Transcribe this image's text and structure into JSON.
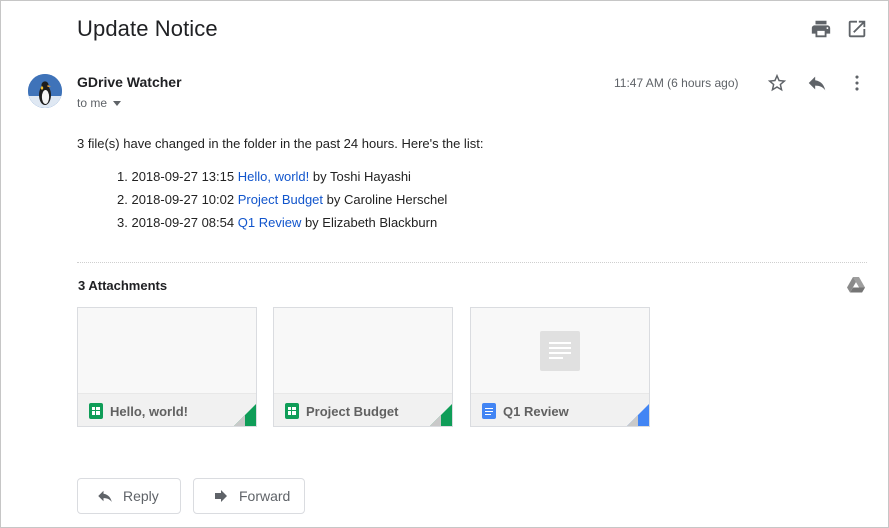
{
  "email": {
    "subject": "Update Notice",
    "sender": "GDrive Watcher",
    "recipient_label": "to me",
    "timestamp": "11:47 AM (6 hours ago)",
    "intro": "3 file(s) have changed in the folder in the past 24 hours. Here's the list:",
    "changes": [
      {
        "number": "1.",
        "datetime": "2018-09-27 13:15",
        "file": "Hello, world!",
        "by": "by Toshi Hayashi"
      },
      {
        "number": "2.",
        "datetime": "2018-09-27 10:02",
        "file": "Project Budget",
        "by": "by Caroline Herschel"
      },
      {
        "number": "3.",
        "datetime": "2018-09-27 08:54",
        "file": "Q1 Review",
        "by": "by Elizabeth Blackburn"
      }
    ]
  },
  "attachments": {
    "title": "3 Attachments",
    "items": [
      {
        "name": "Hello, world!",
        "type": "sheet",
        "icon": "sheets-icon",
        "color": "#0f9d58"
      },
      {
        "name": "Project Budget",
        "type": "sheet",
        "icon": "sheets-icon",
        "color": "#0f9d58"
      },
      {
        "name": "Q1 Review",
        "type": "doc",
        "icon": "docs-icon",
        "color": "#4285f4"
      }
    ]
  },
  "actions": {
    "reply_label": "Reply",
    "forward_label": "Forward"
  },
  "icons": {
    "print": "print-icon",
    "open_new_window": "open-in-new-window-icon",
    "star": "star-icon",
    "reply": "reply-icon",
    "more": "more-vertical-icon",
    "drive": "google-drive-icon"
  },
  "colors": {
    "link": "#1155cc",
    "sheets": "#0f9d58",
    "docs": "#4285f4"
  }
}
